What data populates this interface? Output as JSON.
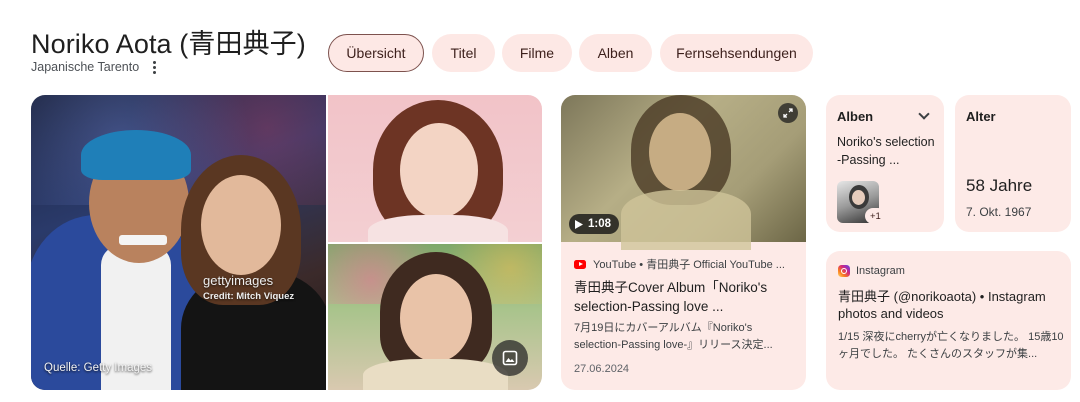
{
  "header": {
    "title": "Noriko Aota (青田典子)",
    "subtitle": "Japanische Tarento"
  },
  "tabs": [
    {
      "label": "Übersicht",
      "selected": true
    },
    {
      "label": "Titel"
    },
    {
      "label": "Filme"
    },
    {
      "label": "Alben"
    },
    {
      "label": "Fernsehsendungen"
    }
  ],
  "gallery": {
    "watermark": "gettyimages",
    "credit": "Credit: Mitch Viquez",
    "source": "Quelle: Getty Images"
  },
  "video": {
    "duration": "1:08",
    "source": "YouTube • 青田典子 Official YouTube ...",
    "title": "青田典子Cover Album「Noriko's selection-Passing love ...",
    "snippet": "7月19日にカバーアルバム『Noriko's selection-Passing love-』リリース決定...",
    "date": "27.06.2024"
  },
  "albums": {
    "label": "Alben",
    "name": "Noriko's selec­tion -Passing ...",
    "more": "+1"
  },
  "age": {
    "label": "Alter",
    "value": "58 Jahre",
    "birthdate": "7. Okt. 1967"
  },
  "instagram": {
    "source": "Instagram",
    "title": "青田典子 (@norikoaota) • Instagram photos and videos",
    "snippet": "1/15 深夜にcherryが亡くなりました。 15歳10ヶ月でした。 たくさんのスタッフが集..."
  },
  "colors": {
    "chip_bg": "#fde8e5",
    "card_bg": "#fdeae7",
    "selected_border": "#7d524e",
    "youtube_red": "#ff0000"
  }
}
